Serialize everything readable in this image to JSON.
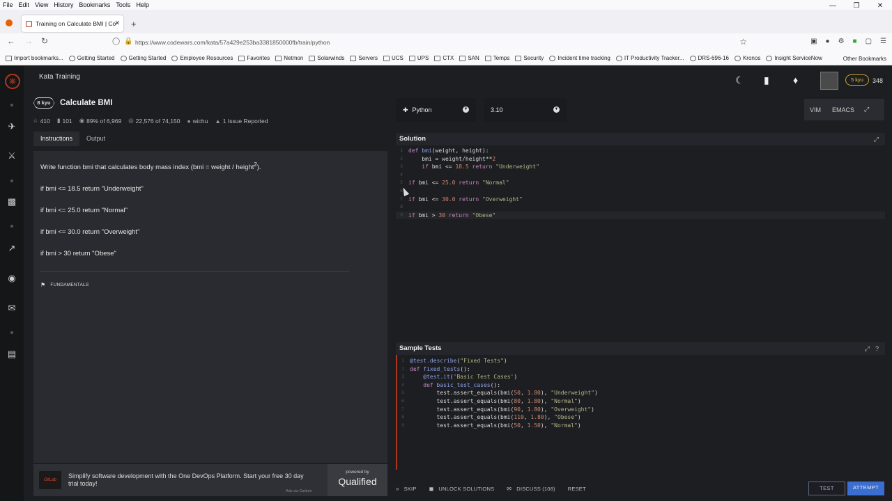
{
  "browser": {
    "menu": [
      "File",
      "Edit",
      "View",
      "History",
      "Bookmarks",
      "Tools",
      "Help"
    ],
    "tab_title": "Training on Calculate BMI | Co",
    "url": "https://www.codewars.com/kata/57a429e253ba3381850000fb/train/python",
    "bookmarks": [
      "Import bookmarks...",
      "Getting Started",
      "Getting Started",
      "Employee Resources",
      "Favorites",
      "Netmon",
      "Solarwinds",
      "Servers",
      "UCS",
      "UPS",
      "CTX",
      "SAN",
      "Temps",
      "Security",
      "Incident time tracking",
      "IT Productivity Tracker...",
      "DRS-696-16",
      "Kronos",
      "Insight ServiceNow"
    ],
    "other_bookmarks": "Other Bookmarks"
  },
  "app": {
    "topbar_title": "Kata Training",
    "user": {
      "rank": "5 kyu",
      "honor": "348"
    }
  },
  "kata": {
    "rank": "8 kyu",
    "name": "Calculate BMI",
    "stars": "410",
    "votes": "101",
    "satisfaction": "89% of 6,969",
    "completed": "22,576 of 74,150",
    "author": "wichu",
    "issues": "1 Issue Reported",
    "tabs": [
      "Instructions",
      "Output"
    ],
    "intro": "Write function bmi that calculates body mass index (bmi = weight / height",
    "intro_sup": "2",
    "intro_end": ").",
    "rules": [
      "if bmi <= 18.5 return \"Underweight\"",
      "if bmi <= 25.0 return \"Normal\"",
      "if bmi <= 30.0 return \"Overweight\"",
      "if bmi > 30 return \"Obese\""
    ],
    "tag": "FUNDAMENTALS"
  },
  "ad": {
    "text": "Simplify software development with the One DevOps Platform. Start your free 30 day trial today!",
    "via": "Ads via Carbon",
    "powered": "powered by",
    "qualified": "Qualified",
    "brand": "GitLab"
  },
  "editor": {
    "language": "Python",
    "version": "3.10",
    "modes": [
      "VIM",
      "EMACS"
    ],
    "solution_title": "Solution",
    "tests_title": "Sample Tests",
    "solution_lines": [
      "def bmi(weight, height):",
      "    bmi = weight/height**2",
      "    if bmi <= 18.5 return \"Underweight\"",
      "",
      "if bmi <= 25.0 return \"Normal\"",
      "",
      "if bmi <= 30.0 return \"Overweight\"",
      "",
      "if bmi > 30 return \"Obese\""
    ],
    "test_lines": [
      "@test.describe(\"Fixed Tests\")",
      "def fixed_tests():",
      "    @test.it('Basic Test Cases')",
      "    def basic_test_cases():",
      "        test.assert_equals(bmi(50, 1.80), \"Underweight\")",
      "        test.assert_equals(bmi(80, 1.80), \"Normal\")",
      "        test.assert_equals(bmi(90, 1.80), \"Overweight\")",
      "        test.assert_equals(bmi(110, 1.80), \"Obese\")",
      "        test.assert_equals(bmi(50, 1.50), \"Normal\")"
    ]
  },
  "actions": {
    "skip": "SKIP",
    "unlock": "UNLOCK SOLUTIONS",
    "discuss": "DISCUSS (108)",
    "reset": "RESET",
    "test": "TEST",
    "attempt": "ATTEMPT"
  }
}
